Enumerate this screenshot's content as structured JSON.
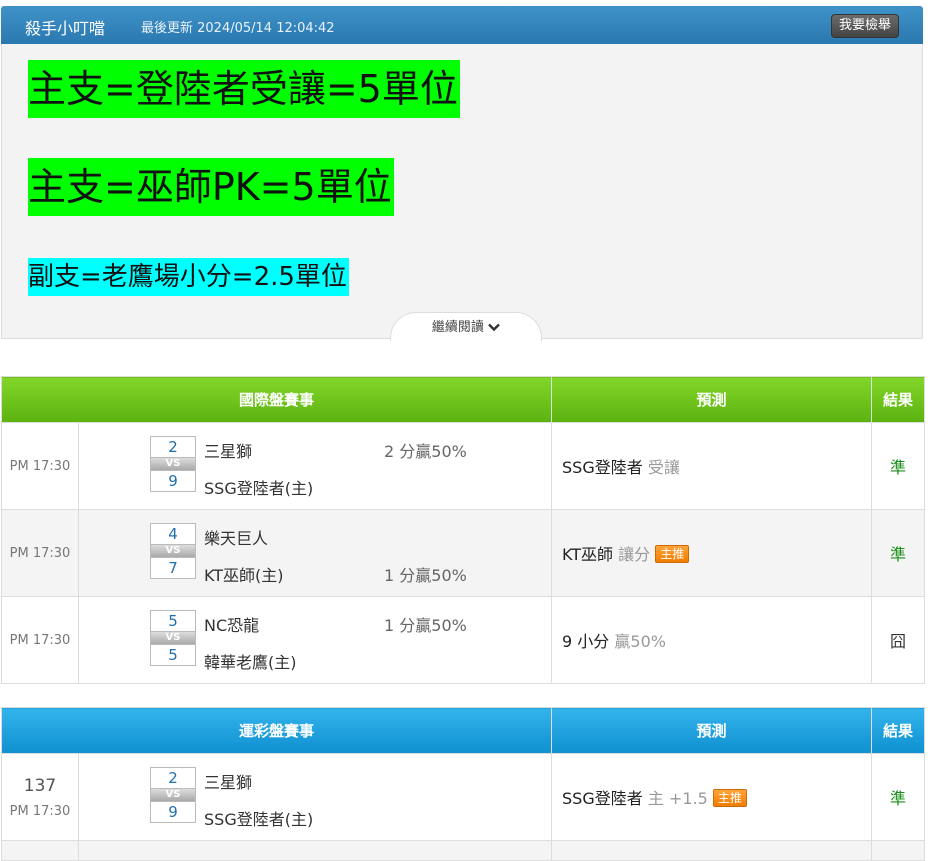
{
  "header": {
    "author": "殺手小叮噹",
    "updated": "最後更新 2024/05/14 12:04:42",
    "report_button": "我要檢舉"
  },
  "article": {
    "line1": "主支=登陸者受讓=5單位",
    "line2": "主支=巫師PK=5單位",
    "line3": "副支=老鷹場小分=2.5單位",
    "more": "繼續閱讀",
    "colors": {
      "highlight_green": "#00ff00",
      "highlight_cyan": "#00ffff"
    }
  },
  "intl_table": {
    "headers": [
      "國際盤賽事",
      "預測",
      "結果"
    ],
    "rows": [
      {
        "time": "PM 17:30",
        "away_score": "2",
        "home_score": "9",
        "vs": "VS",
        "away": "三星獅",
        "home": "SSG登陸者(主)",
        "away_odds": "2 分贏50%",
        "home_odds": "",
        "pred_team": "SSG登陸者",
        "pred_sub": "受讓",
        "badge": "",
        "result": "準"
      },
      {
        "time": "PM 17:30",
        "away_score": "4",
        "home_score": "7",
        "vs": "VS",
        "away": "樂天巨人",
        "home": "KT巫師(主)",
        "away_odds": "",
        "home_odds": "1 分贏50%",
        "pred_team": "KT巫師",
        "pred_sub": "讓分",
        "badge": "主推",
        "result": "準"
      },
      {
        "time": "PM 17:30",
        "away_score": "5",
        "home_score": "5",
        "vs": "VS",
        "away": "NC恐龍",
        "home": "韓華老鷹(主)",
        "away_odds": "1 分贏50%",
        "home_odds": "",
        "pred_team": "9 小分",
        "pred_sub": "贏50%",
        "badge": "",
        "result": "囧"
      }
    ]
  },
  "lottery_table": {
    "headers": [
      "運彩盤賽事",
      "預測",
      "結果"
    ],
    "rows": [
      {
        "num": "137",
        "time": "PM 17:30",
        "away_score": "2",
        "home_score": "9",
        "vs": "VS",
        "away": "三星獅",
        "home": "SSG登陸者(主)",
        "pred_team": "SSG登陸者",
        "pred_sub": "主 +1.5",
        "badge": "主推",
        "result": "準"
      }
    ]
  }
}
